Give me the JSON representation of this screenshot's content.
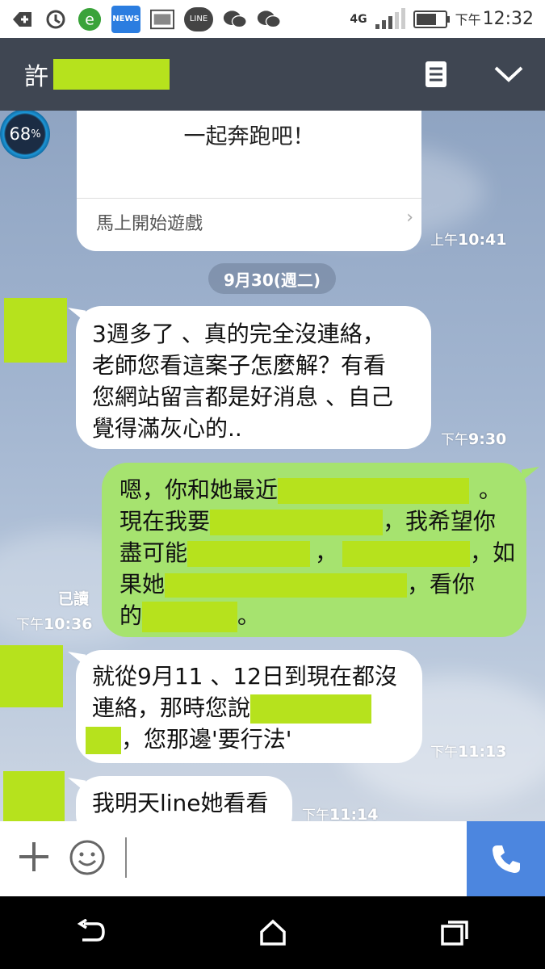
{
  "status_bar": {
    "icons": [
      "add-icon",
      "sync-icon",
      "ie-icon",
      "news-icon",
      "image-icon",
      "line-icon",
      "wechat-icon",
      "wechat-icon"
    ],
    "news_label": "NEWS",
    "line_label": "LINE",
    "network": "4G",
    "time_prefix": "下午",
    "time": "12:32"
  },
  "header": {
    "title_char": "許",
    "menu_icon": "menu-list-icon",
    "collapse_icon": "chevron-down-icon"
  },
  "colors": {
    "header_bg": "#3f4652",
    "outgoing_bubble": "#a6e36f",
    "incoming_bubble": "#ffffff",
    "redaction": "#b6e21d",
    "call_button": "#4c86df"
  },
  "chat": {
    "badge_value": "68",
    "badge_unit": "%",
    "game_card": {
      "text": "一起奔跑吧！",
      "link": "馬上開始遊戲",
      "time_prefix": "上午",
      "time": "10:41"
    },
    "date_separator": "9月30(週二)",
    "messages": [
      {
        "direction": "in",
        "lines": [
          "3週多了 、真的完全沒連絡，",
          "老師您看這案子怎麼解？有看",
          "您網站留言都是好消息 、自己",
          "覺得滿灰心的.."
        ],
        "time_prefix": "下午",
        "time": "9:30"
      },
      {
        "direction": "out",
        "line1_start": "嗯，你和她最近",
        "line1_end": "。",
        "line2_start": "現在我要",
        "line2_end": "，我希望你",
        "line3_start": "盡可能",
        "line3_mid": "，",
        "line3_end": "，如",
        "line4_start": "果她",
        "line4_end": "，看你",
        "line5_start": "的",
        "line5_end": "。",
        "read_label": "已讀",
        "time_prefix": "下午",
        "time": "10:36"
      },
      {
        "direction": "in",
        "line1": "就從9月11 、12日到現在都沒",
        "line2_start": "連絡，那時您說",
        "line3_end": "，您那邊'要行法'",
        "time_prefix": "下午",
        "time": "11:13"
      },
      {
        "direction": "in",
        "text": "我明天line她看看",
        "time_prefix": "下午",
        "time": "11:14"
      }
    ]
  },
  "input_bar": {
    "plus_icon": "plus-icon",
    "emoji_icon": "emoji-icon",
    "call_icon": "phone-icon"
  },
  "nav_bar": {
    "icons": [
      "back-icon",
      "home-icon",
      "recents-icon"
    ]
  }
}
